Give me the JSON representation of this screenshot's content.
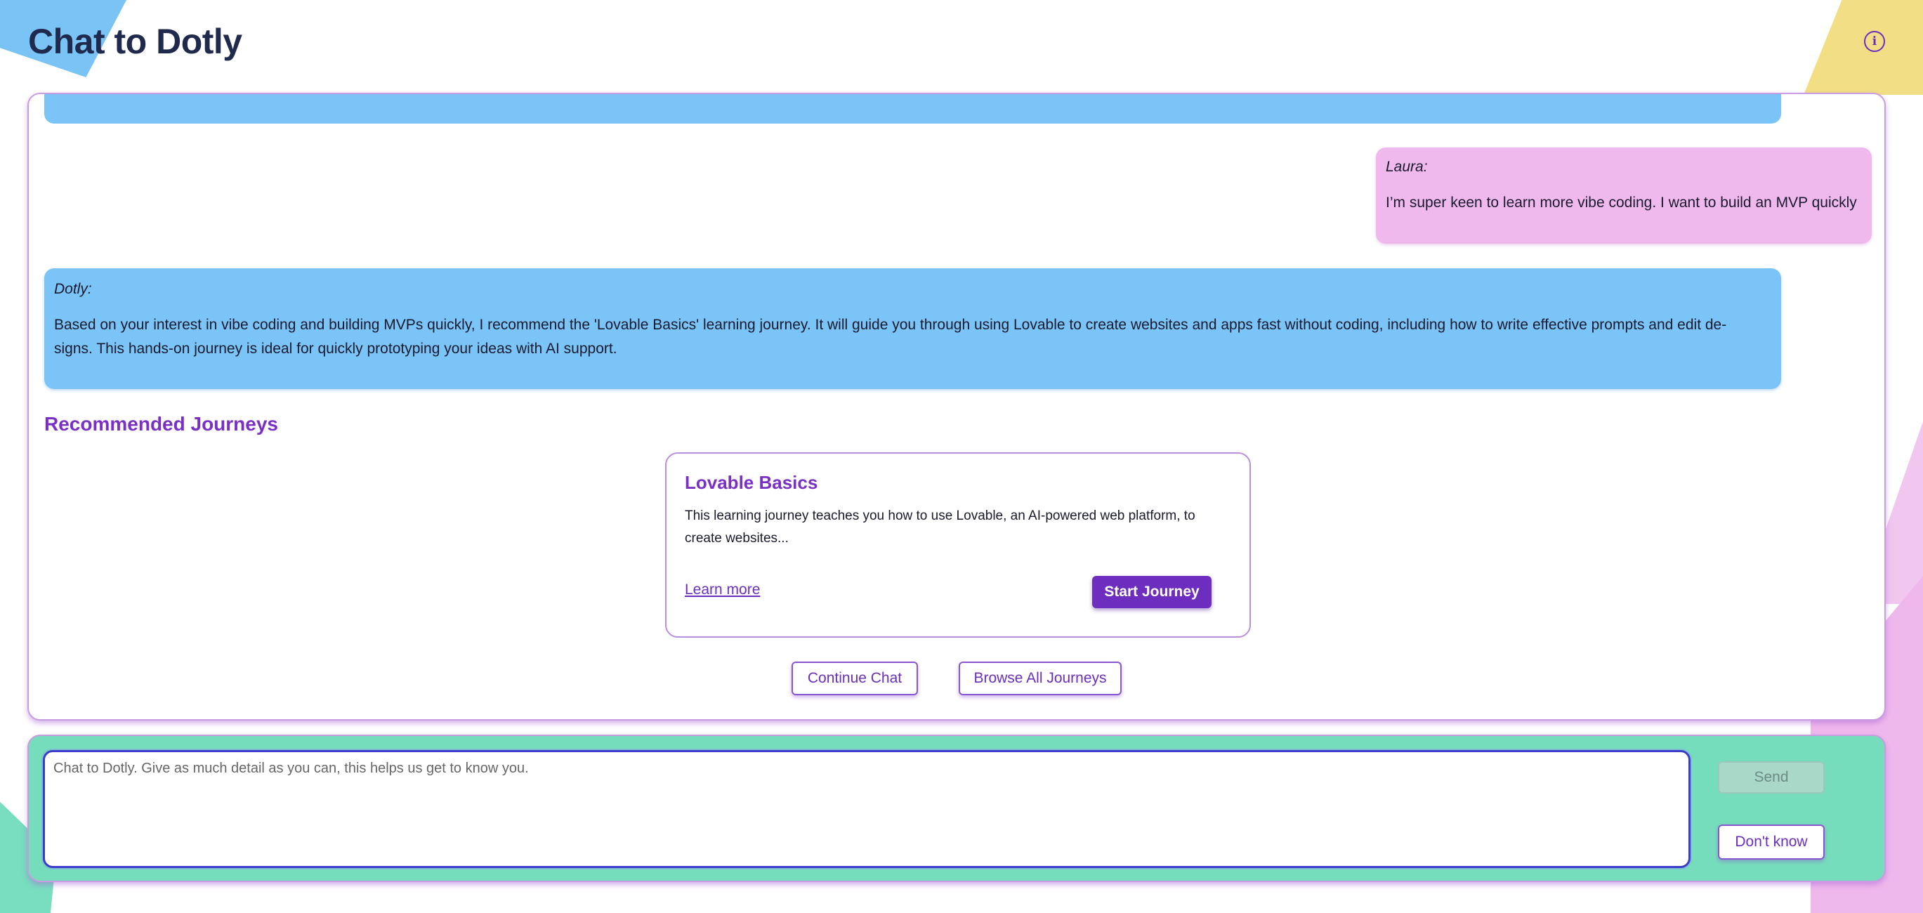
{
  "header": {
    "title": "Chat to Dotly",
    "info_icon": "info-circle-icon",
    "info_glyph": "i"
  },
  "colors": {
    "accent": "#6d2dbf",
    "bot_bubble": "#7ac4f7",
    "user_bubble": "#efb9ee",
    "input_panel": "#76ddbc"
  },
  "messages": [
    {
      "sender": "Laura:",
      "role": "user",
      "text": "I’m super keen to learn more vibe coding. I want to build an MVP quickly"
    },
    {
      "sender": "Dotly:",
      "role": "bot",
      "line1": "Based on your interest in vibe coding and building MVPs quickly, I recommend the 'Lovable Basics' learning journey. It will guide you through using Lovable to create websites and apps fast without coding, including how to write effective prompts and edit de-",
      "line2": "signs. This hands-on journey is ideal for quickly prototyping your ideas with AI support."
    }
  ],
  "recommendations": {
    "heading": "Recommended Journeys",
    "journeys": [
      {
        "title": "Lovable Basics",
        "description": "This learning journey teaches you how to use Lovable, an AI-powered web platform, to create websites...",
        "learn_more_label": "Learn more",
        "start_label": "Start Journey"
      }
    ],
    "continue_label": "Continue Chat",
    "browse_label": "Browse All Journeys"
  },
  "composer": {
    "placeholder": "Chat to Dotly. Give as much detail as you can, this helps us get to know you.",
    "send_label": "Send",
    "dont_know_label": "Don't know"
  }
}
